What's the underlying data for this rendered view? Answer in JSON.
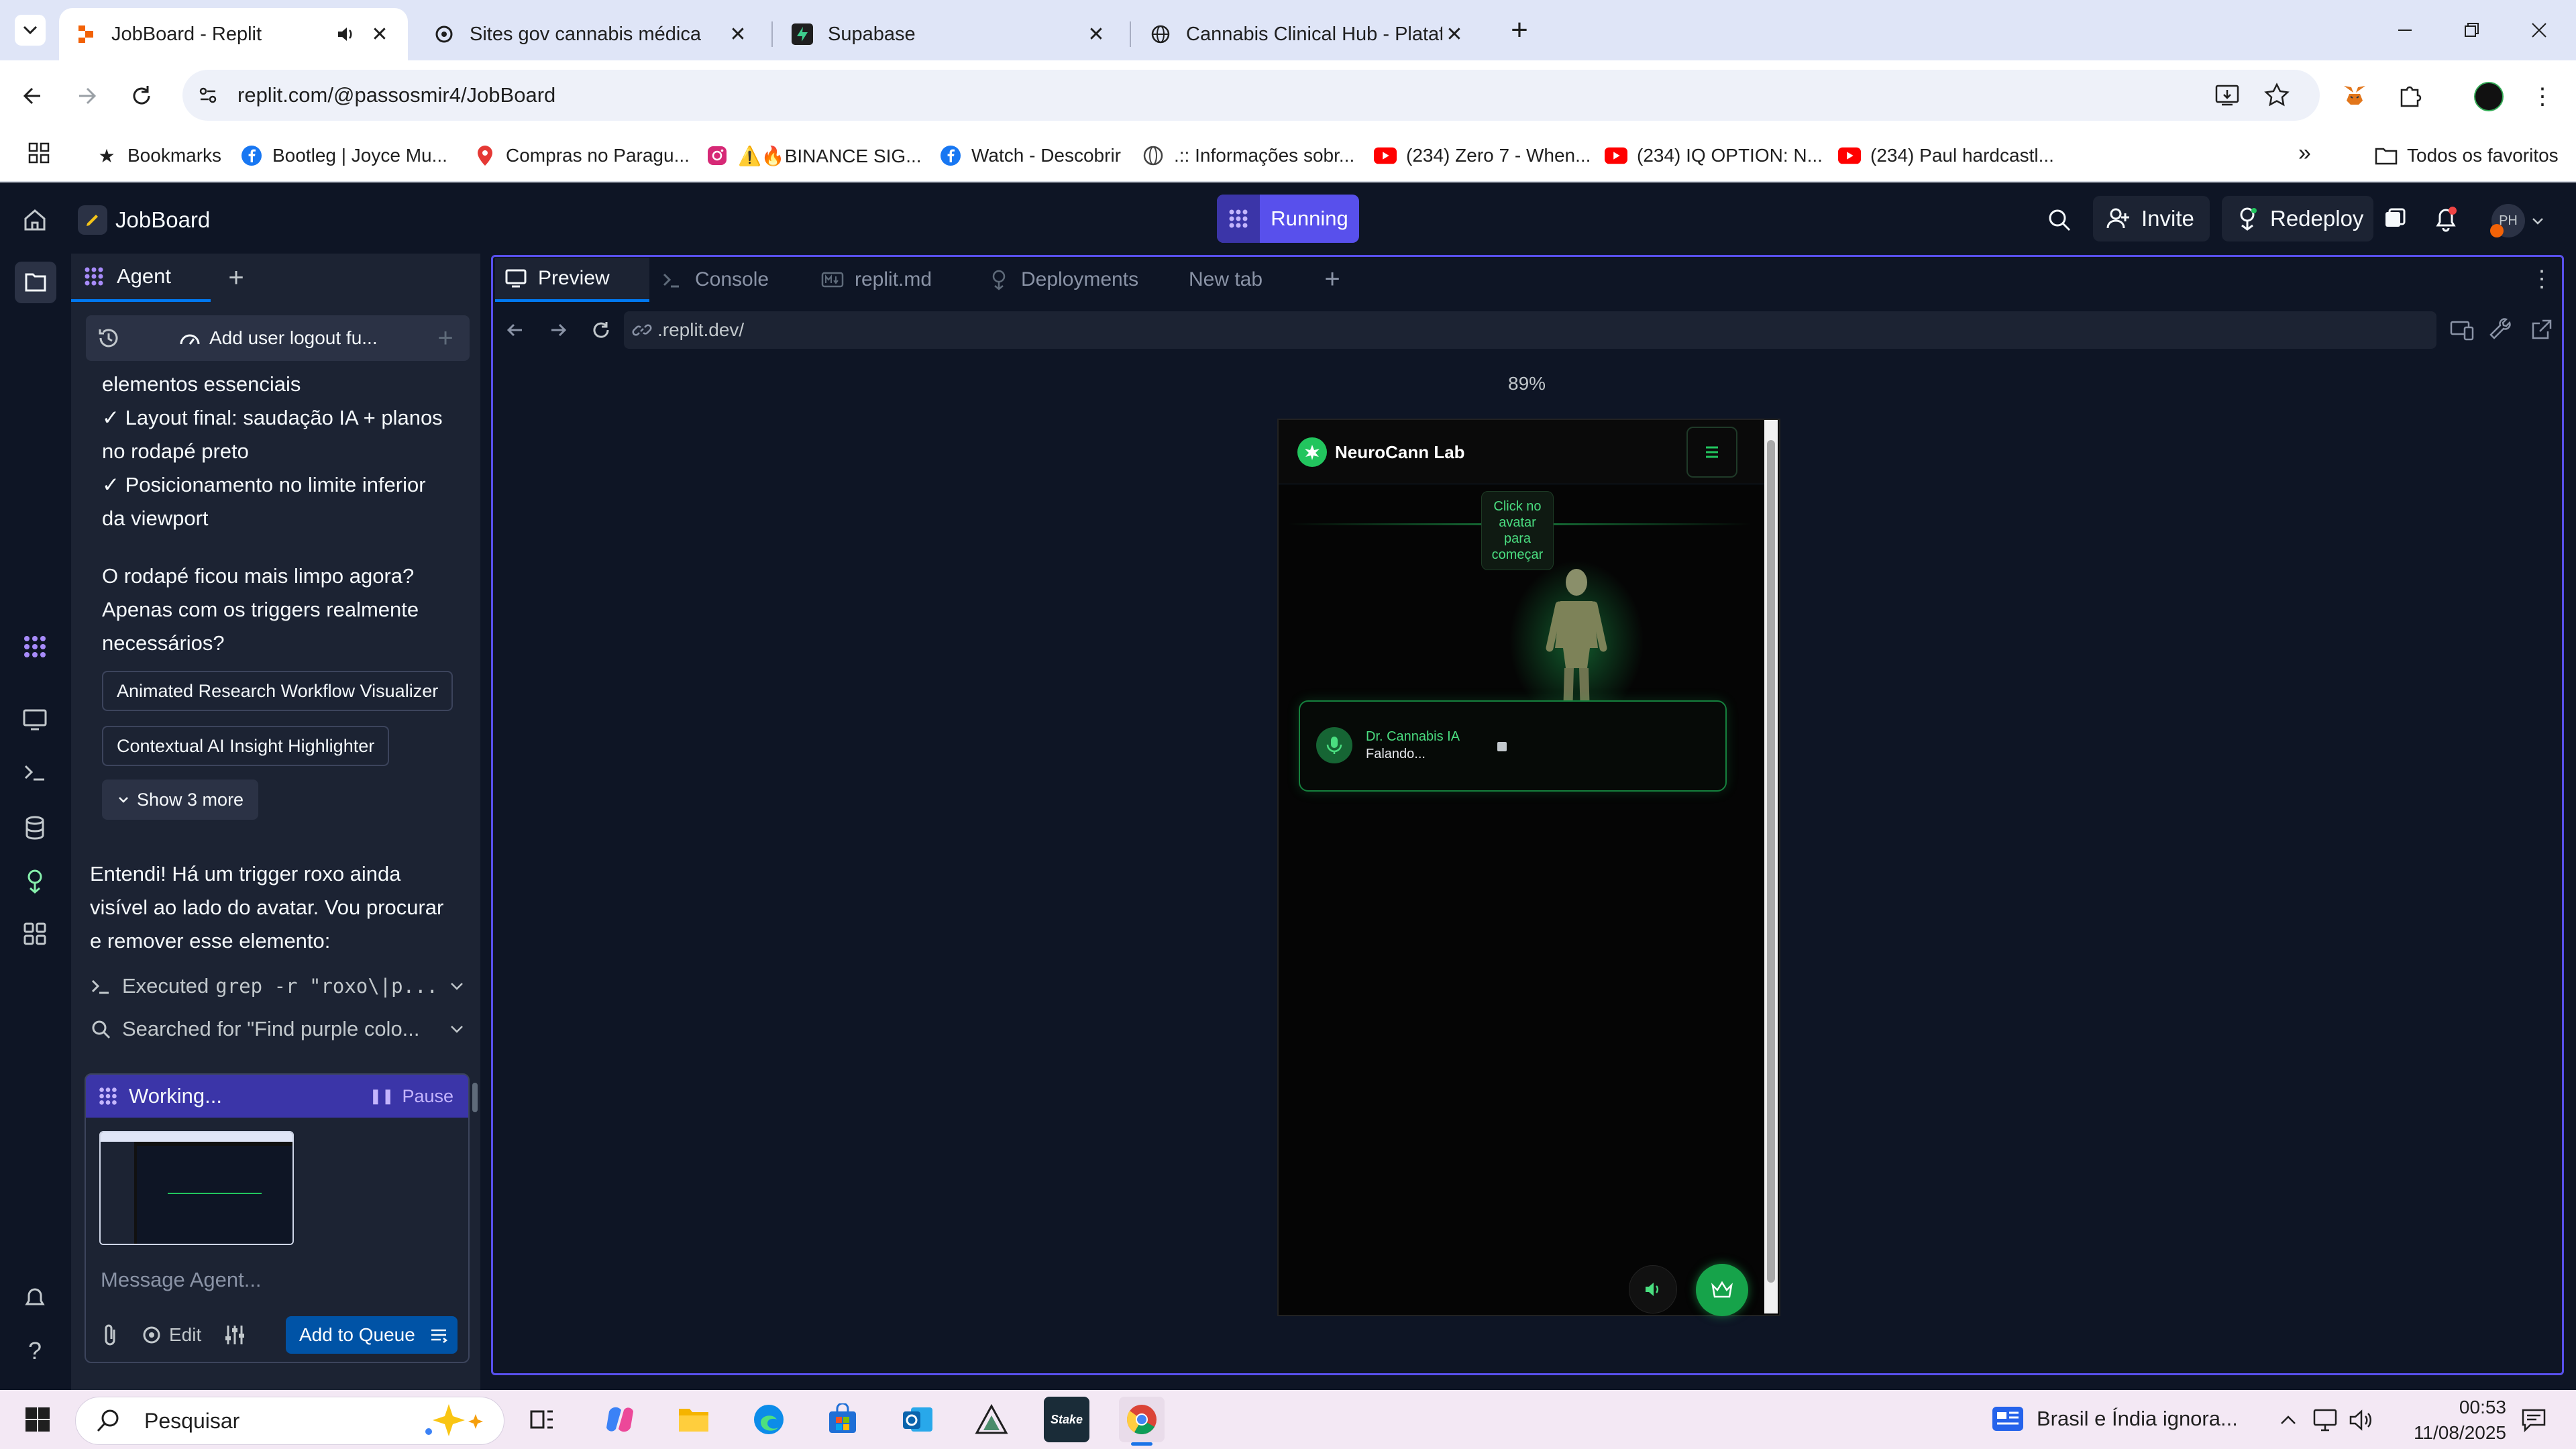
{
  "browser": {
    "tabs": [
      {
        "title": "JobBoard - Replit",
        "icon": "replit-logo-icon",
        "active": true
      },
      {
        "title": "Sites gov cannabis médica",
        "icon": "openai-logo-icon"
      },
      {
        "title": "Supabase",
        "icon": "supabase-logo-icon"
      },
      {
        "title": "Cannabis Clinical Hub - Plataform",
        "icon": "globe-icon"
      }
    ],
    "url": "replit.com/@passosmir4/JobBoard",
    "bookmarks": [
      {
        "label": "Bookmarks",
        "icon": "star-icon"
      },
      {
        "label": "Bootleg | Joyce Mu...",
        "icon": "facebook-icon"
      },
      {
        "label": "Compras no Paragu...",
        "icon": "map-pin-icon"
      },
      {
        "label": "⚠️🔥BINANCE SIG...",
        "icon": "instagram-icon"
      },
      {
        "label": "Watch - Descobrir",
        "icon": "facebook-icon"
      },
      {
        "label": ".:: Informações sobr...",
        "icon": "globe-icon"
      },
      {
        "label": "(234) Zero 7 - When...",
        "icon": "youtube-icon"
      },
      {
        "label": "(234) IQ OPTION: N...",
        "icon": "youtube-icon"
      },
      {
        "label": "(234) Paul hardcastl...",
        "icon": "youtube-icon"
      }
    ],
    "all_bookmarks": "Todos os favoritos"
  },
  "replit": {
    "project": "JobBoard",
    "status": "Running",
    "invite": "Invite",
    "redeploy": "Redeploy",
    "avatar": "PH",
    "agent_tab": "Agent",
    "thread_title": "Add user logout fu...",
    "messages": {
      "checklist": [
        "elementos essenciais",
        "✓ Layout final: saudação IA + planos",
        "no rodapé preto",
        "✓ Posicionamento no limite inferior",
        "da viewport"
      ],
      "question": [
        "O rodapé ficou mais limpo agora?",
        "Apenas com os triggers realmente",
        "necessários?"
      ],
      "suggestions": [
        "Animated Research Workflow Visualizer",
        "Contextual AI Insight Highlighter"
      ],
      "show_more": "Show 3 more",
      "reply": [
        "Entendi! Há um trigger roxo ainda",
        "visível ao lado do avatar. Vou procurar",
        "e remover esse elemento:"
      ],
      "actions": [
        {
          "prefix": "Executed",
          "code": "grep -r \"roxo\\|p...",
          "icon": "terminal-icon"
        },
        {
          "prefix": "",
          "code": "Searched for \"Find purple colo...",
          "icon": "search-icon"
        }
      ]
    },
    "working": {
      "label": "Working...",
      "pause": "Pause"
    },
    "composer": {
      "placeholder": "Message Agent...",
      "edit": "Edit",
      "add_to_queue": "Add to Queue"
    },
    "workspace_tabs": [
      {
        "label": "Preview",
        "icon": "monitor-icon",
        "active": true
      },
      {
        "label": "Console",
        "icon": "terminal-icon"
      },
      {
        "label": "replit.md",
        "icon": "markdown-icon"
      },
      {
        "label": "Deployments",
        "icon": "deploy-icon"
      },
      {
        "label": "New tab",
        "icon": ""
      }
    ],
    "preview_url": ".replit.dev/",
    "zoom": "89%"
  },
  "app_preview": {
    "brand": "NeuroCann Lab",
    "tooltip": [
      "Click no",
      "avatar",
      "para",
      "começar"
    ],
    "assistant_name": "Dr. Cannabis IA",
    "assistant_status": "Falando...",
    "accent": "#22c55e"
  },
  "taskbar": {
    "search": "Pesquisar",
    "news": "Brasil e Índia ignora...",
    "time": "00:53",
    "date": "11/08/2025"
  }
}
